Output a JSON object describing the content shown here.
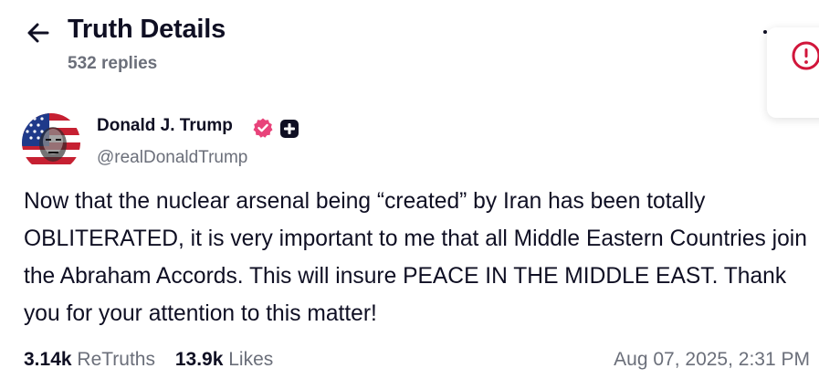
{
  "header": {
    "title": "Truth Details",
    "reply_count": "532 replies"
  },
  "post": {
    "author": {
      "name": "Donald J. Trump",
      "handle": "@realDonaldTrump"
    },
    "body": "Now that the nuclear arsenal being “created” by Iran has been totally OBLITERATED, it is very important to me that all Middle Eastern Countries join the Abraham Accords. This will insure PEACE IN THE MIDDLE EAST. Thank you for your attention to this matter!",
    "stats": {
      "retruths_count": "3.14k",
      "retruths_label": "ReTruths",
      "likes_count": "13.9k",
      "likes_label": "Likes"
    },
    "timestamp": "Aug 07, 2025, 2:31 PM"
  },
  "icons": {
    "back": "arrow-left-icon",
    "verified": "verified-badge-icon",
    "plus": "plus-badge-icon",
    "alert": "alert-circle-icon"
  },
  "colors": {
    "text": "#0f0f23",
    "muted": "#6b6f7a",
    "verified": "#e8437a",
    "alert": "#d1163b"
  }
}
